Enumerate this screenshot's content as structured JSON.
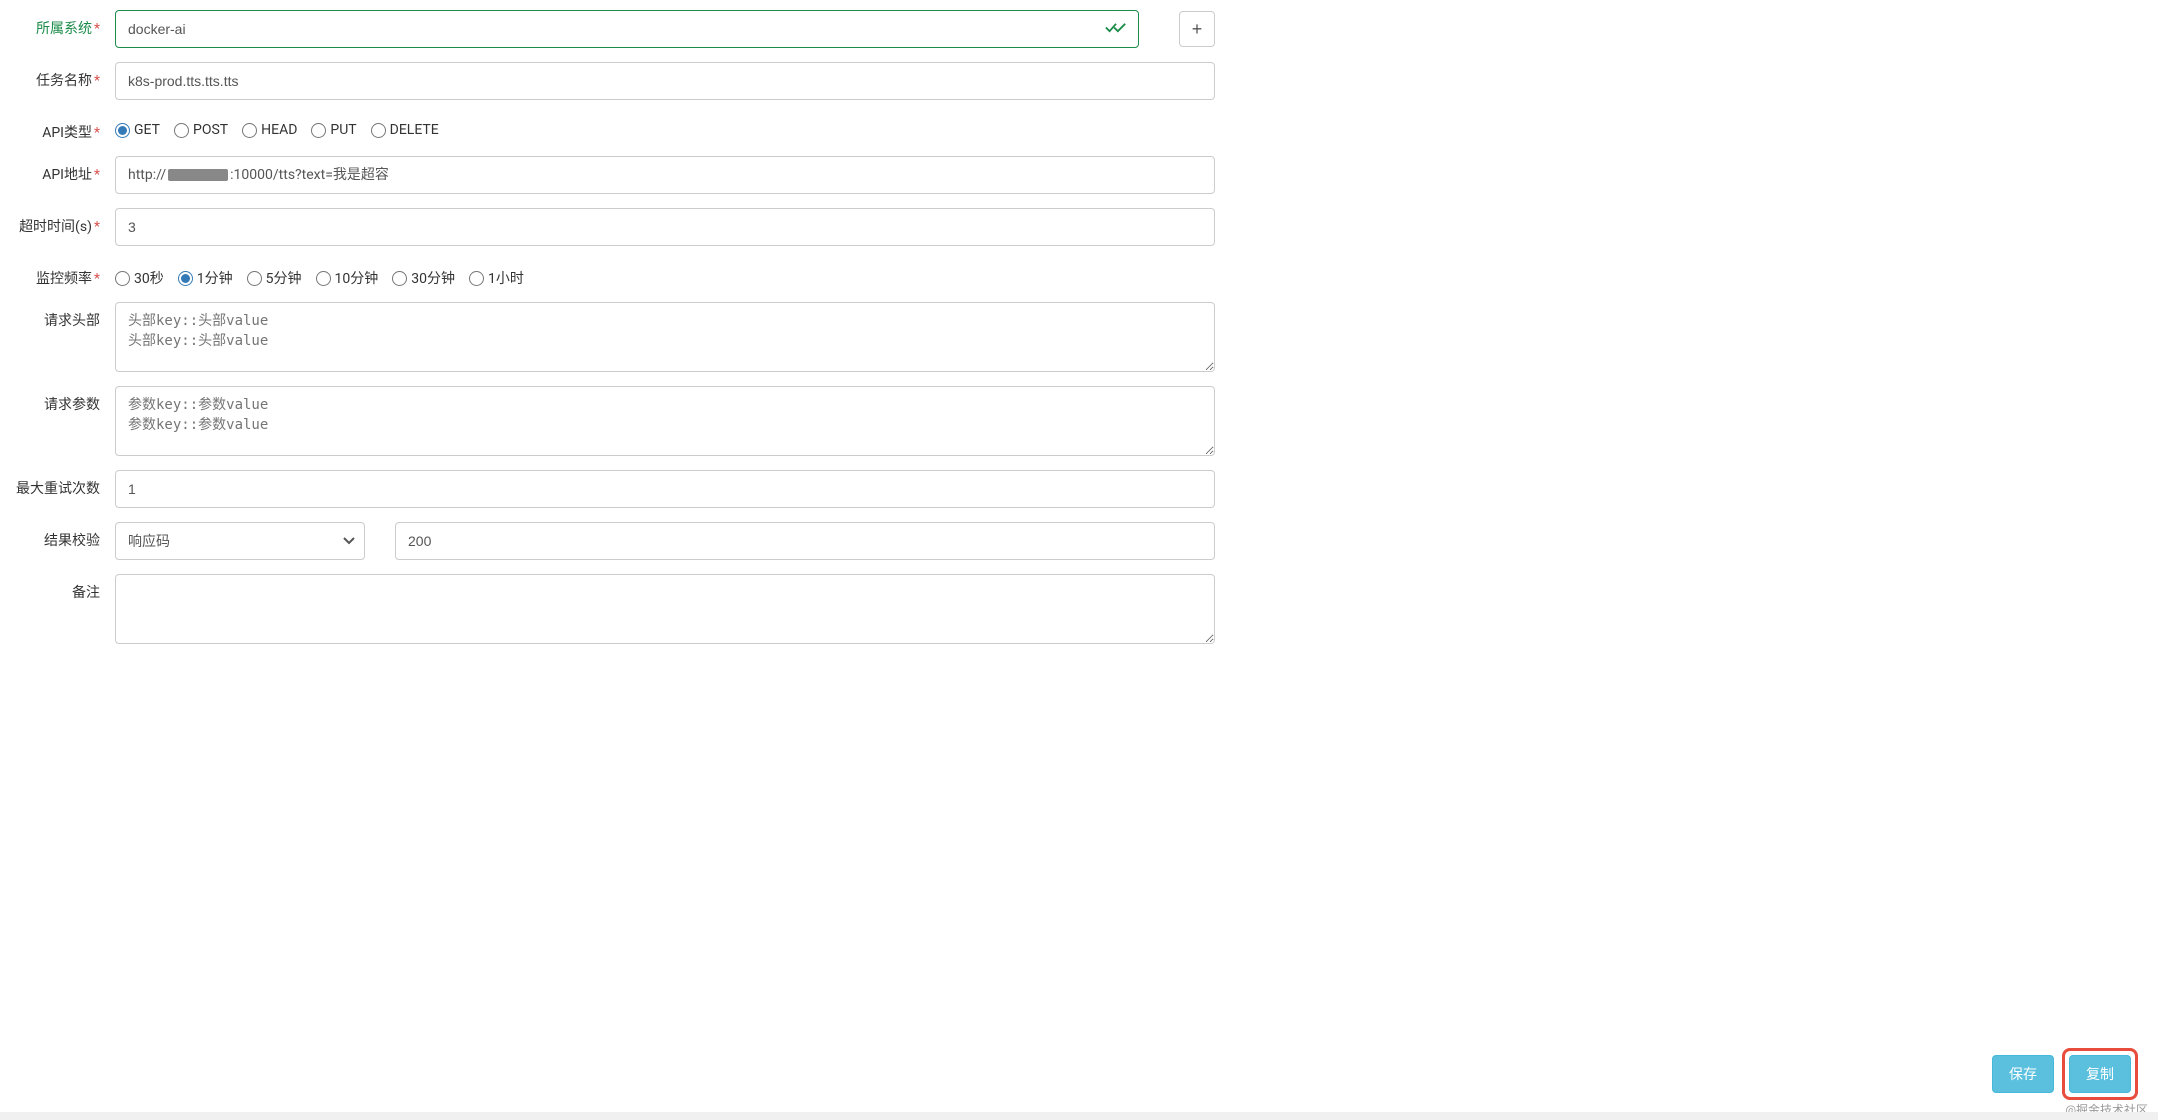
{
  "form": {
    "system": {
      "label": "所属系统",
      "value": "docker-ai"
    },
    "task_name": {
      "label": "任务名称",
      "value": "k8s-prod.tts.tts.tts"
    },
    "api_type": {
      "label": "API类型",
      "selected": "GET",
      "options": [
        "GET",
        "POST",
        "HEAD",
        "PUT",
        "DELETE"
      ]
    },
    "api_url": {
      "label": "API地址",
      "prefix": "http://",
      "suffix": ":10000/tts?text=我是超容",
      "value": "http://[redacted]:10000/tts?text=我是超容"
    },
    "timeout": {
      "label": "超时时间(s)",
      "value": "3"
    },
    "frequency": {
      "label": "监控频率",
      "selected": "1分钟",
      "options": [
        "30秒",
        "1分钟",
        "5分钟",
        "10分钟",
        "30分钟",
        "1小时"
      ]
    },
    "headers": {
      "label": "请求头部",
      "placeholder": "头部key::头部value\n头部key::头部value",
      "value": ""
    },
    "params": {
      "label": "请求参数",
      "placeholder": "参数key::参数value\n参数key::参数value",
      "value": ""
    },
    "max_retry": {
      "label": "最大重试次数",
      "value": "1"
    },
    "verify": {
      "label": "结果校验",
      "type": "响应码",
      "value": "200"
    },
    "remark": {
      "label": "备注",
      "value": ""
    }
  },
  "buttons": {
    "save": "保存",
    "copy": "复制",
    "add": "+"
  },
  "watermark": "@掘金技术社区"
}
